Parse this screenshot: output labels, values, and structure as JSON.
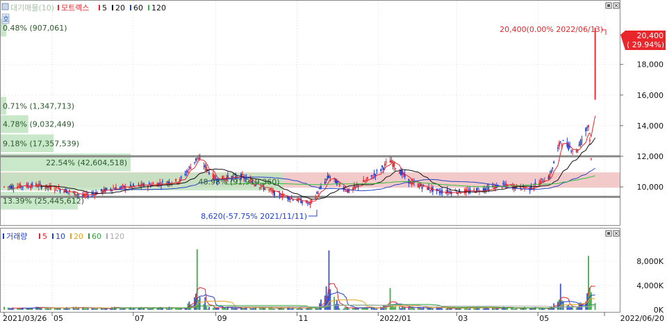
{
  "price_legend": {
    "prefix_label": "대기매물(10)",
    "stock_name": "모트렉스",
    "ma_items": [
      {
        "label": "5",
        "color": "#e8262b"
      },
      {
        "label": "20",
        "color": "#111111"
      },
      {
        "label": "60",
        "color": "#2340c8"
      },
      {
        "label": "120",
        "color": "#2fbf3a"
      }
    ],
    "side_tab_label": "호"
  },
  "volume_legend": {
    "title": "거래량",
    "ma_items": [
      {
        "label": "5",
        "color": "#e8262b"
      },
      {
        "label": "10",
        "color": "#2340c8"
      },
      {
        "label": "20",
        "color": "#e8a21c"
      },
      {
        "label": "60",
        "color": "#2fa23a"
      },
      {
        "label": "120",
        "color": "#aaaaaa"
      }
    ]
  },
  "colors": {
    "up": "#e8262b",
    "down": "#1f3fd1",
    "ma5": "#e8262b",
    "ma20": "#111111",
    "ma60": "#2340c8",
    "ma120": "#2fbf3a",
    "supply_band": "#bfe3bf",
    "pink_band": "#f2c4c4",
    "horizontal_line": "#888888"
  },
  "chart_data": [
    {
      "type": "candlestick",
      "title": "모트렉스",
      "y_ticks": [
        10000,
        12000,
        14000,
        16000,
        18000
      ],
      "y_tick_labels": [
        "10,000",
        "12,000",
        "14,000",
        "16,000",
        "18,000"
      ],
      "ylim": [
        7600,
        21300
      ],
      "x_ticks": [
        "2021/03/26",
        "05",
        "07",
        "09",
        "11",
        "2022/01",
        "03",
        "05",
        "2022/06/20"
      ],
      "current_price_label": "20,400",
      "current_change_label": "( 29.94%)",
      "high_annotation": "20,400(0.00% 2022/06/13)",
      "low_annotation": "8,620(-57.75% 2021/11/11)",
      "horizontal_lines": [
        12000,
        9350
      ],
      "pink_band": [
        9950,
        10950
      ],
      "supply_profile": [
        {
          "label": "0.48% (907,061)",
          "price": 20400,
          "fraction": 0.0048
        },
        {
          "label": "0.71% (1,347,713)",
          "price": 15300,
          "fraction": 0.0071
        },
        {
          "label": "4.78% (9,032,449)",
          "price": 14100,
          "fraction": 0.0478
        },
        {
          "label": "9.18% (17,357,539)",
          "price": 12850,
          "fraction": 0.0918
        },
        {
          "label": "22.54% (42,604,518)",
          "price": 11600,
          "fraction": 0.2254
        },
        {
          "label": "48.98% (91,919,360)",
          "price": 10350,
          "fraction": 0.4898
        },
        {
          "label": "13.39% (25,445,612)",
          "price": 9100,
          "fraction": 0.1339
        }
      ],
      "closing_path": [
        {
          "date": "2021/03/26",
          "close": 10000
        },
        {
          "date": "2021/04/20",
          "close": 10100
        },
        {
          "date": "2021/05/10",
          "close": 9800
        },
        {
          "date": "2021/05/25",
          "close": 9400
        },
        {
          "date": "2021/06/15",
          "close": 9900
        },
        {
          "date": "2021/07/10",
          "close": 10100
        },
        {
          "date": "2021/08/05",
          "close": 10400
        },
        {
          "date": "2021/08/18",
          "close": 11900
        },
        {
          "date": "2021/09/01",
          "close": 10500
        },
        {
          "date": "2021/09/20",
          "close": 10700
        },
        {
          "date": "2021/10/15",
          "close": 9600
        },
        {
          "date": "2021/11/11",
          "close": 8900
        },
        {
          "date": "2021/11/25",
          "close": 10700
        },
        {
          "date": "2021/12/10",
          "close": 9700
        },
        {
          "date": "2021/12/28",
          "close": 10700
        },
        {
          "date": "2022/01/10",
          "close": 11700
        },
        {
          "date": "2022/01/25",
          "close": 10300
        },
        {
          "date": "2022/02/15",
          "close": 9700
        },
        {
          "date": "2022/03/10",
          "close": 9700
        },
        {
          "date": "2022/04/05",
          "close": 10100
        },
        {
          "date": "2022/04/25",
          "close": 9900
        },
        {
          "date": "2022/05/10",
          "close": 10700
        },
        {
          "date": "2022/05/18",
          "close": 13000
        },
        {
          "date": "2022/05/30",
          "close": 12300
        },
        {
          "date": "2022/06/08",
          "close": 14100
        },
        {
          "date": "2022/06/10",
          "close": 12000
        },
        {
          "date": "2022/06/13",
          "close": 20400
        }
      ]
    },
    {
      "type": "bar",
      "title": "거래량",
      "y_ticks": [
        0,
        4000,
        8000
      ],
      "y_tick_labels": [
        "0K",
        "4,000K",
        "8,000K"
      ],
      "ylim": [
        0,
        11000
      ],
      "volume_spikes_k": [
        {
          "date": "2021/08/18",
          "value": 10000
        },
        {
          "date": "2021/11/25",
          "value": 9800
        },
        {
          "date": "2022/01/10",
          "value": 3600
        },
        {
          "date": "2022/05/18",
          "value": 4300
        },
        {
          "date": "2022/06/08",
          "value": 8900
        }
      ]
    }
  ]
}
